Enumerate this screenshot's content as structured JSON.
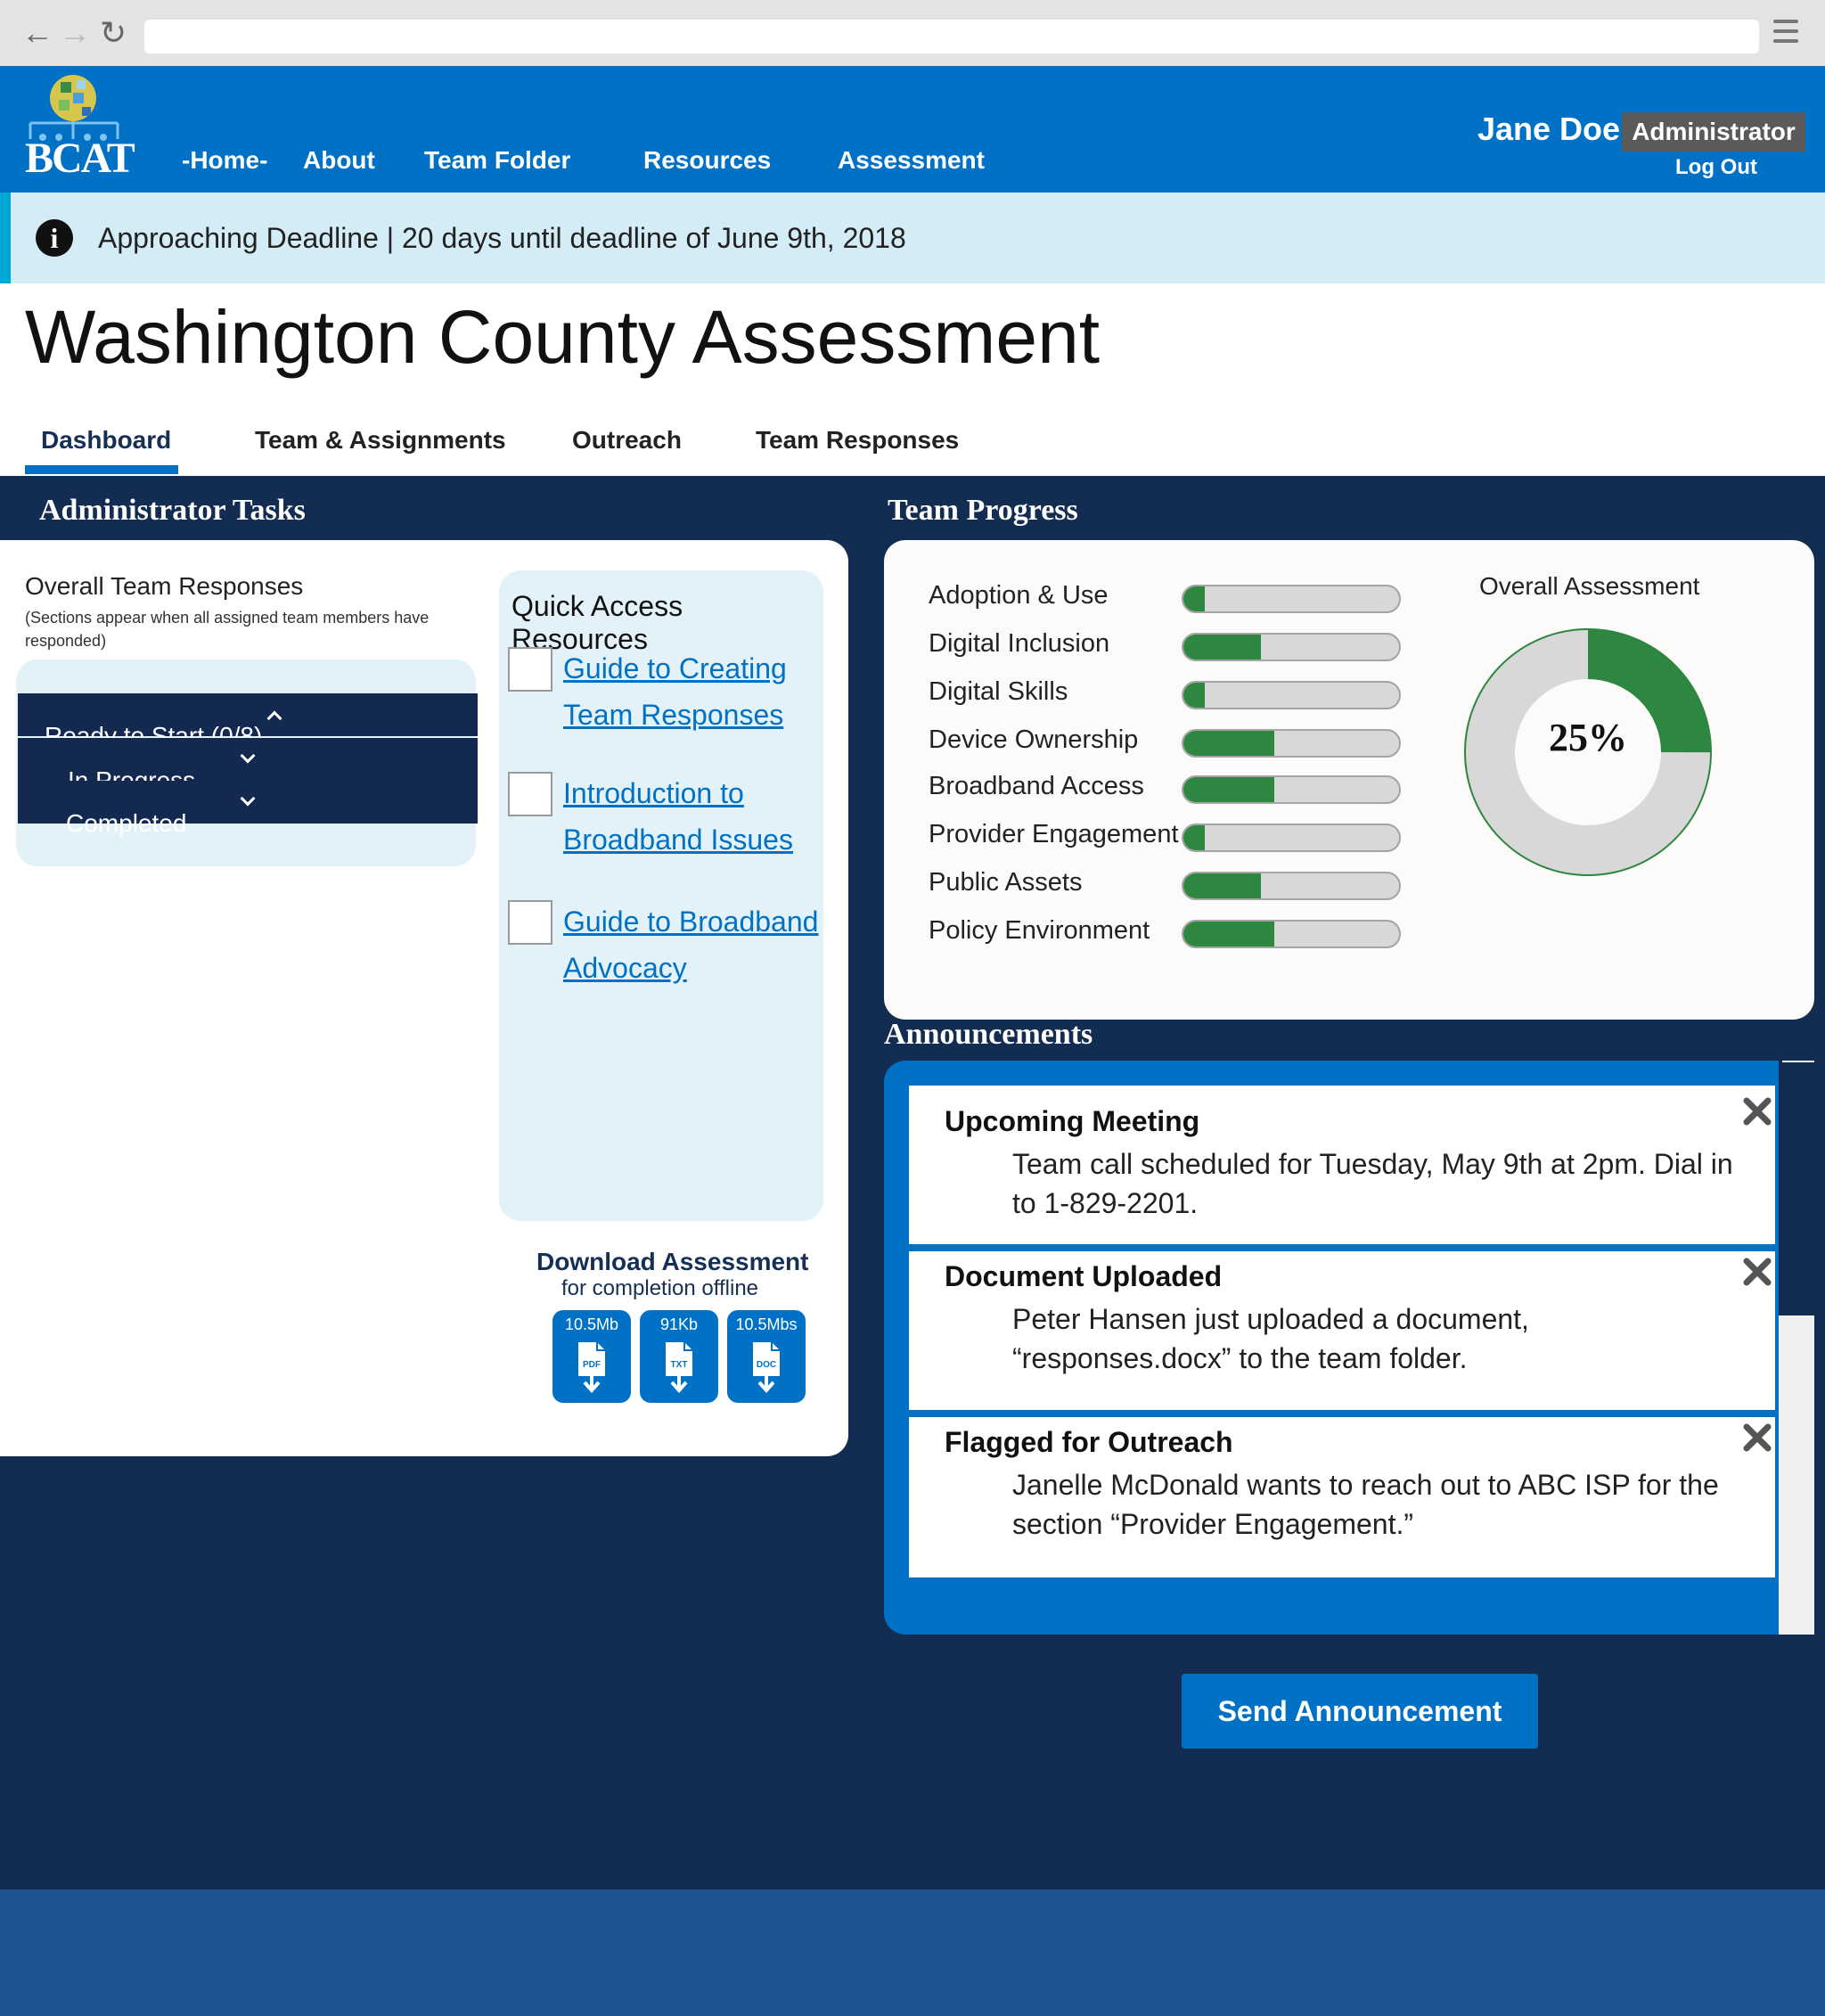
{
  "header": {
    "logo_text": "BCAT",
    "nav": [
      "-Home-",
      "About",
      "Team Folder",
      "Resources",
      "Assessment"
    ],
    "user_name": "Jane Doe",
    "role": "Administrator",
    "logout": "Log Out"
  },
  "alert": {
    "message": "Approaching Deadline | 20 days until deadline of June 9th, 2018"
  },
  "page": {
    "title": "Washington County Assessment",
    "tabs": [
      "Dashboard",
      "Team & Assignments",
      "Outreach",
      "Team Responses"
    ],
    "active_tab": "Dashboard"
  },
  "admin_tasks": {
    "heading": "Administrator Tasks",
    "overall_title": "Overall Team  Responses",
    "overall_sub": "(Sections appear when all assigned team members have responded)",
    "accordion": [
      "Ready to Start (0/8)",
      "In Progress",
      "Completed"
    ],
    "quick_access": {
      "title": "Quick Access Resources",
      "links": [
        "Guide to Creating Team Responses",
        "Introduction to Broadband Issues",
        "Guide to Broadband Advocacy"
      ]
    },
    "download": {
      "title": "Download Assessment",
      "sub": "for completion offline",
      "files": [
        {
          "size": "10.5Mb",
          "type": "PDF"
        },
        {
          "size": "91Kb",
          "type": "TXT"
        },
        {
          "size": "10.5Mbs",
          "type": "DOC"
        }
      ]
    }
  },
  "team_progress": {
    "heading": "Team Progress",
    "sections": [
      {
        "label": "Adoption & Use",
        "fraction": 0.1
      },
      {
        "label": "Digital Inclusion",
        "fraction": 0.36
      },
      {
        "label": "Digital Skills",
        "fraction": 0.1
      },
      {
        "label": "Device Ownership",
        "fraction": 0.42
      },
      {
        "label": "Broadband Access",
        "fraction": 0.42
      },
      {
        "label": "Provider Engagement",
        "fraction": 0.1
      },
      {
        "label": "Public Assets",
        "fraction": 0.36
      },
      {
        "label": "Policy Environment",
        "fraction": 0.42
      }
    ],
    "overall_title": "Overall Assessment",
    "overall_percent": "25%",
    "overall_fraction": 0.25
  },
  "announcements": {
    "heading": "Announcements",
    "items": [
      {
        "title": "Upcoming Meeting",
        "body": "Team call scheduled for Tuesday, May 9th at 2pm.  Dial in to 1-829-2201."
      },
      {
        "title": "Document Uploaded",
        "body": "Peter Hansen just uploaded a document, “responses.docx” to the team folder."
      },
      {
        "title": "Flagged for Outreach",
        "body": "Janelle McDonald wants to reach out to  ABC ISP for the section “Provider Engagement.”"
      }
    ],
    "send_button": "Send Announcement"
  },
  "colors": {
    "brand_blue": "#0071c5",
    "navy": "#132c52",
    "progress_green": "#2e8740",
    "alert_bg": "#d4ecf6"
  }
}
